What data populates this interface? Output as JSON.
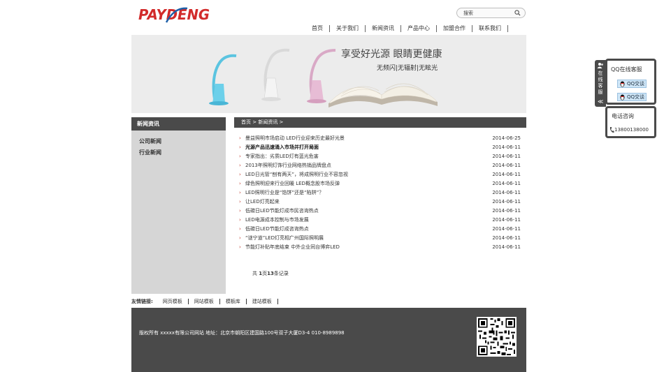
{
  "colors": {
    "brand_red": "#d22b2b",
    "brand_blue": "#1e5fa8",
    "dark_bar": "#4a4a4a",
    "bullet_red": "#c0392b"
  },
  "header": {
    "logo_text": "PAYDENG",
    "search": {
      "placeholder": "搜索",
      "icon": "search-icon"
    },
    "nav": [
      "首页",
      "关于我们",
      "新闻资讯",
      "产品中心",
      "加盟合作",
      "联系我们"
    ]
  },
  "banner": {
    "headline": "享受好光源 眼睛更健康",
    "subline": "无频闪|无辐射|无眩光"
  },
  "sidebar": {
    "title": "新闻资讯",
    "links": [
      "公司新闻",
      "行业新闻"
    ]
  },
  "breadcrumb": "首页 > 新闻资讯 >",
  "news": [
    {
      "title": "曼益照明市场启动 LED行业迎来历史最好光景",
      "date": "2014-06-25",
      "bold": false
    },
    {
      "title": "光源产品迅速涌入市场并打开局面",
      "date": "2014-06-11",
      "bold": true
    },
    {
      "title": "专家指出：劣质LED灯有蓝光危害",
      "date": "2014-06-11",
      "bold": false
    },
    {
      "title": "2013年照明灯饰行业网络热销品牌盘点",
      "date": "2014-06-11",
      "bold": false
    },
    {
      "title": "LED日光管“刨有两天”，将成照明行业不容忽视",
      "date": "2014-06-11",
      "bold": false
    },
    {
      "title": "绿色照明迎来行业回暖 LED概念股市场反弹",
      "date": "2014-06-11",
      "bold": false
    },
    {
      "title": "LED照明行业是“馅饼”还是“陷阱”？",
      "date": "2014-06-11",
      "bold": false
    },
    {
      "title": "让LED灯亮起来",
      "date": "2014-06-11",
      "bold": false
    },
    {
      "title": "低碳日LED节能灯成市民咨询热点",
      "date": "2014-06-11",
      "bold": false
    },
    {
      "title": "LED电源成本控制与市场发展",
      "date": "2014-06-11",
      "bold": false
    },
    {
      "title": "低碳日LED节能灯成咨询热点",
      "date": "2014-06-11",
      "bold": false
    },
    {
      "title": "“谜宁道”LED灯亮相广州国际照明展",
      "date": "2014-06-11",
      "bold": false
    },
    {
      "title": "节能灯补贴年底结束 中外企业同台博弈LED",
      "date": "2014-06-11",
      "bold": false
    }
  ],
  "pager": {
    "prefix": "共",
    "page": "1",
    "mid": "页",
    "count": "13",
    "suffix": "条记录"
  },
  "friend_links": {
    "label": "友情链接:",
    "items": [
      "网页模板",
      "网站模板",
      "模板库",
      "建站模板"
    ]
  },
  "footer": {
    "text": "版权所有 xxxxx有限公司网站 地址：北京市朝阳区建国路100号双子大厦D3-4 010-8989898"
  },
  "service": {
    "tab_label": [
      "在",
      "线",
      "客",
      "服"
    ],
    "tab_chevron": "≪",
    "qq_title": "QQ在线客服",
    "qq_buttons": [
      "QQ交谈",
      "QQ交谈"
    ],
    "phone_title": "电话咨询",
    "phone_number": "13800138000"
  }
}
